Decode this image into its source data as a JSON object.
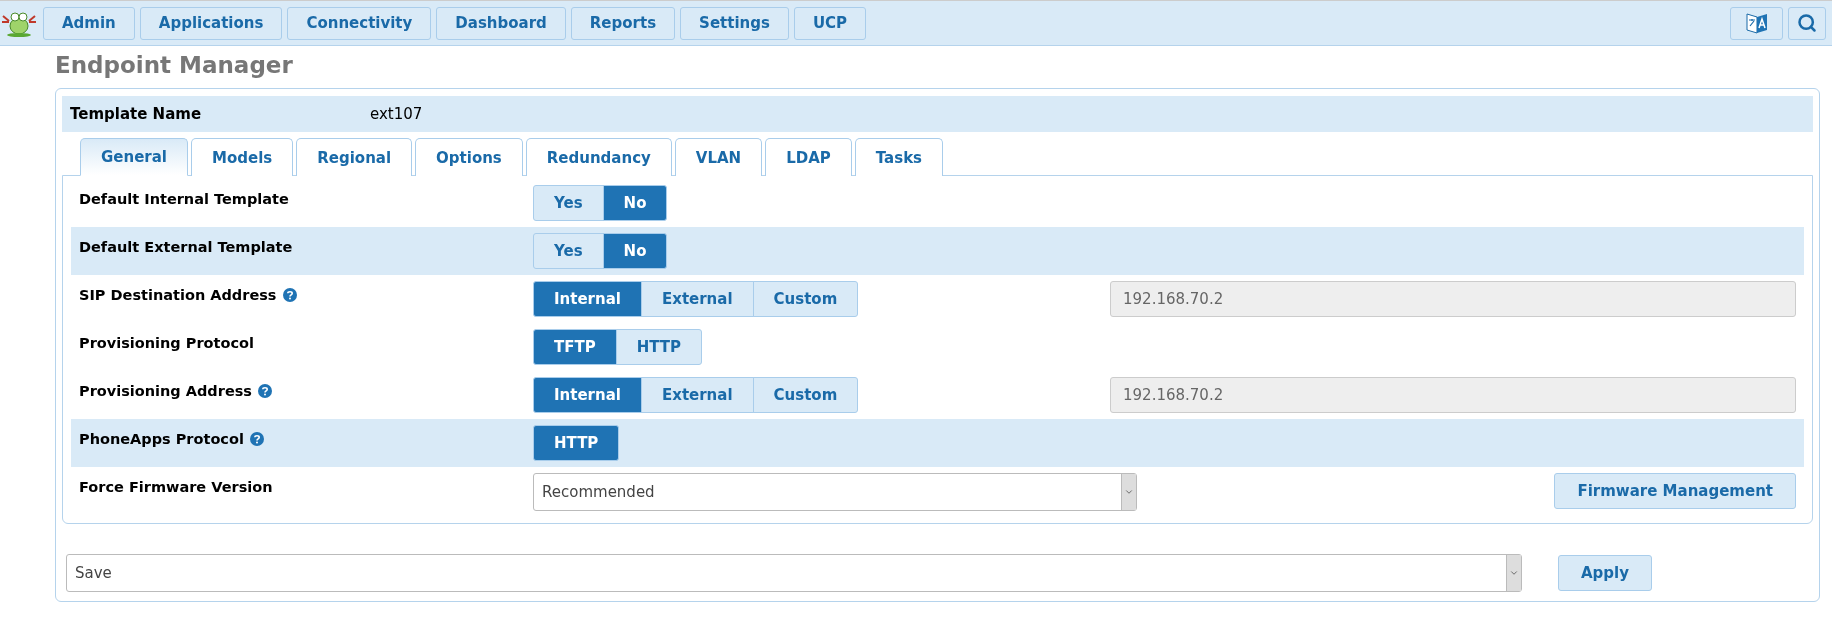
{
  "nav": {
    "items": [
      {
        "label": "Admin"
      },
      {
        "label": "Applications"
      },
      {
        "label": "Connectivity"
      },
      {
        "label": "Dashboard"
      },
      {
        "label": "Reports"
      },
      {
        "label": "Settings"
      },
      {
        "label": "UCP"
      }
    ]
  },
  "page_title": "Endpoint Manager",
  "template": {
    "label": "Template Name",
    "value": "ext107"
  },
  "tabs": [
    {
      "label": "General",
      "selected": true
    },
    {
      "label": "Models",
      "selected": false
    },
    {
      "label": "Regional",
      "selected": false
    },
    {
      "label": "Options",
      "selected": false
    },
    {
      "label": "Redundancy",
      "selected": false
    },
    {
      "label": "VLAN",
      "selected": false
    },
    {
      "label": "LDAP",
      "selected": false
    },
    {
      "label": "Tasks",
      "selected": false
    }
  ],
  "rows": [
    {
      "kind": "toggle",
      "label": "Default Internal Template",
      "help": false,
      "highlighted": false,
      "options": [
        {
          "label": "Yes",
          "selected": false
        },
        {
          "label": "No",
          "selected": true
        }
      ]
    },
    {
      "kind": "toggle",
      "label": "Default External Template",
      "help": false,
      "highlighted": true,
      "options": [
        {
          "label": "Yes",
          "selected": false
        },
        {
          "label": "No",
          "selected": true
        }
      ]
    },
    {
      "kind": "toggle",
      "label": "SIP Destination Address",
      "help": true,
      "highlighted": false,
      "options": [
        {
          "label": "Internal",
          "selected": true
        },
        {
          "label": "External",
          "selected": false
        },
        {
          "label": "Custom",
          "selected": false
        }
      ],
      "field_value": "192.168.70.2"
    },
    {
      "kind": "toggle",
      "label": "Provisioning Protocol",
      "help": false,
      "highlighted": false,
      "options": [
        {
          "label": "TFTP",
          "selected": true
        },
        {
          "label": "HTTP",
          "selected": false
        }
      ]
    },
    {
      "kind": "toggle",
      "label": "Provisioning Address",
      "help": true,
      "highlighted": false,
      "options": [
        {
          "label": "Internal",
          "selected": true
        },
        {
          "label": "External",
          "selected": false
        },
        {
          "label": "Custom",
          "selected": false
        }
      ],
      "field_value": "192.168.70.2"
    },
    {
      "kind": "toggle",
      "label": "PhoneApps Protocol",
      "help": true,
      "highlighted": true,
      "options": [
        {
          "label": "HTTP",
          "selected": true
        }
      ]
    },
    {
      "kind": "select",
      "label": "Force Firmware Version",
      "help": false,
      "highlighted": false,
      "value": "Recommended",
      "button": "Firmware Management"
    }
  ],
  "footer": {
    "action": "Save",
    "button": "Apply"
  }
}
